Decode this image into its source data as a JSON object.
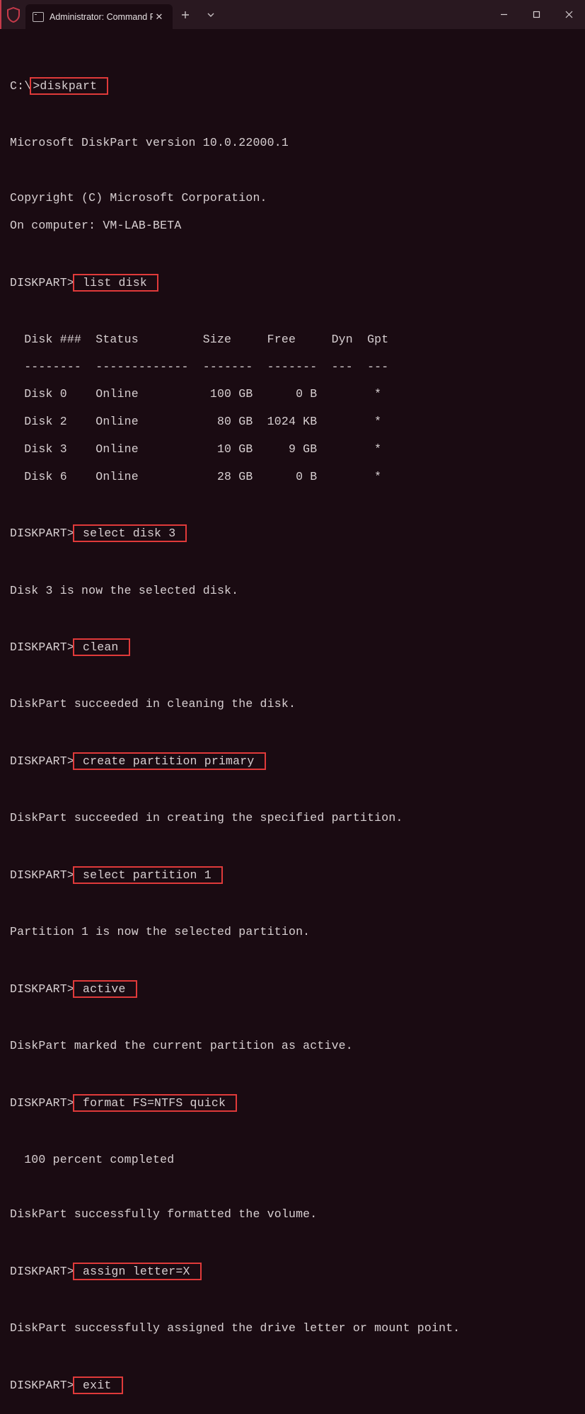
{
  "titlebar": {
    "tab_title": "Administrator: Command Prom"
  },
  "term": {
    "prompt_c": "C:\\",
    "cmd_diskpart": ">diskpart ",
    "version": "Microsoft DiskPart version 10.0.22000.1",
    "copyright": "Copyright (C) Microsoft Corporation.",
    "computer": "On computer: VM-LAB-BETA",
    "prompt_dp": "DISKPART>",
    "cmd_listdisk": " list disk ",
    "table": {
      "header": "  Disk ###  Status         Size     Free     Dyn  Gpt",
      "divider": "  --------  -------------  -------  -------  ---  ---",
      "rows": [
        "  Disk 0    Online          100 GB      0 B        *",
        "  Disk 2    Online           80 GB  1024 KB        *",
        "  Disk 3    Online           10 GB     9 GB        *",
        "  Disk 6    Online           28 GB      0 B        *"
      ]
    },
    "cmd_select_disk": " select disk 3 ",
    "msg_select_disk": "Disk 3 is now the selected disk.",
    "cmd_clean": " clean ",
    "msg_clean": "DiskPart succeeded in cleaning the disk.",
    "cmd_create_part": " create partition primary ",
    "msg_create_part": "DiskPart succeeded in creating the specified partition.",
    "cmd_select_part": " select partition 1 ",
    "msg_select_part": "Partition 1 is now the selected partition.",
    "cmd_active": " active ",
    "msg_active": "DiskPart marked the current partition as active.",
    "cmd_format": " format FS=NTFS quick ",
    "msg_format_progress": "  100 percent completed",
    "msg_format_done": "DiskPart successfully formatted the volume.",
    "cmd_assign": " assign letter=X ",
    "msg_assign": "DiskPart successfully assigned the drive letter or mount point.",
    "cmd_exit": " exit "
  }
}
